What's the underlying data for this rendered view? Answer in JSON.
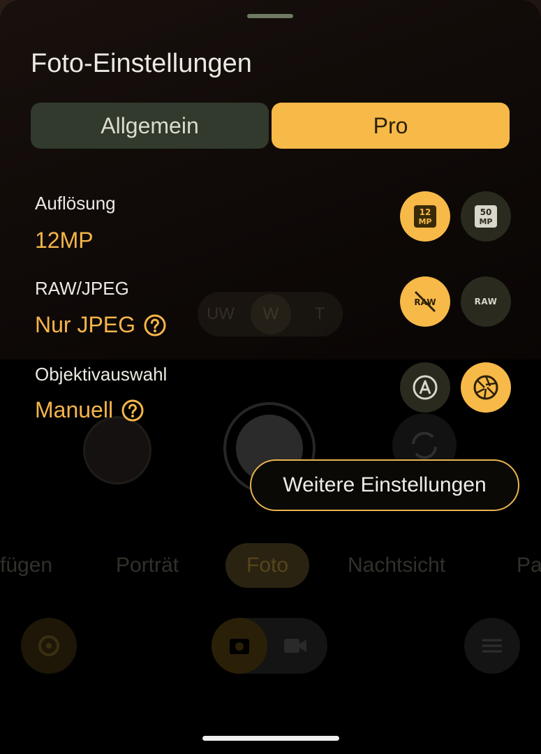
{
  "sheet": {
    "title": "Foto-Einstellungen",
    "tabs": {
      "general": "Allgemein",
      "pro": "Pro",
      "selected": "Pro"
    }
  },
  "settings": {
    "resolution": {
      "label": "Auflösung",
      "value": "12MP",
      "options": [
        "12 MP",
        "50 MP"
      ],
      "selected": "12 MP"
    },
    "raw_jpeg": {
      "label": "RAW/JPEG",
      "value": "Nur JPEG",
      "options": [
        "RAW off",
        "RAW"
      ],
      "selected": "RAW off",
      "raw_on_label": "RAW",
      "raw_off_label": "RAW"
    },
    "lens": {
      "label": "Objektivauswahl",
      "value": "Manuell",
      "options": [
        "Automatisch",
        "Manuell"
      ],
      "selected": "Manuell"
    }
  },
  "more_settings_label": "Weitere Einstellungen",
  "background": {
    "zoom": {
      "uw": "UW",
      "w": "W",
      "t": "T"
    },
    "modes": [
      "fügen",
      "Porträt",
      "Foto",
      "Nachtsicht",
      "Pa"
    ],
    "active_mode": "Foto"
  },
  "colors": {
    "accent": "#f7b948",
    "inactive_chip": "#2b2a1f",
    "tab_inactive": "#313a2c"
  },
  "icons": [
    "help-icon",
    "12mp-icon",
    "50mp-icon",
    "raw-off-icon",
    "raw-icon",
    "auto-lens-icon",
    "aperture-icon",
    "settings-gear-icon",
    "camera-icon",
    "video-icon",
    "sliders-icon",
    "switch-camera-icon"
  ]
}
